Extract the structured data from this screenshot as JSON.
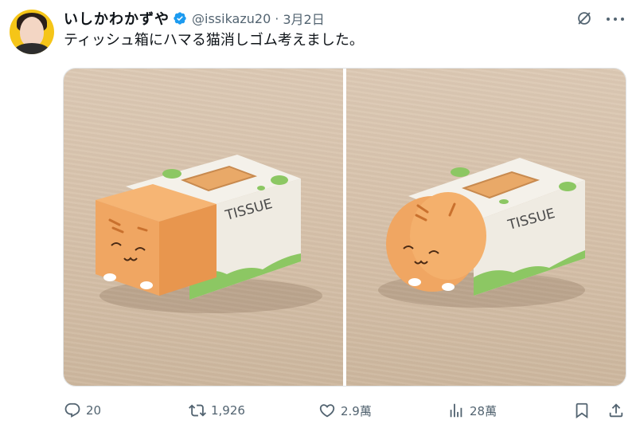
{
  "author": {
    "display_name": "いしかわかずや",
    "handle": "@issikazu20",
    "separator": "·",
    "date": "3月2日"
  },
  "tweet": {
    "text": "ティッシュ箱にハマる猫消しゴム考えました。"
  },
  "media": {
    "left_box_label": "TISSUE",
    "right_box_label": "TISSUE"
  },
  "actions": {
    "replies": "20",
    "retweets": "1,926",
    "likes": "2.9萬",
    "views": "28萬"
  },
  "icons": {
    "verified": "verified-badge-icon",
    "grok": "grok-icon",
    "more": "more-icon",
    "reply": "reply-icon",
    "retweet": "retweet-icon",
    "like": "heart-icon",
    "views": "views-chart-icon",
    "bookmark": "bookmark-icon",
    "share": "share-icon"
  },
  "colors": {
    "verified_blue": "#1d9bf0",
    "secondary_text": "#536471",
    "avatar_bg": "#f5c518",
    "cat_orange": "#f0a662",
    "box_green": "#8cc763"
  }
}
